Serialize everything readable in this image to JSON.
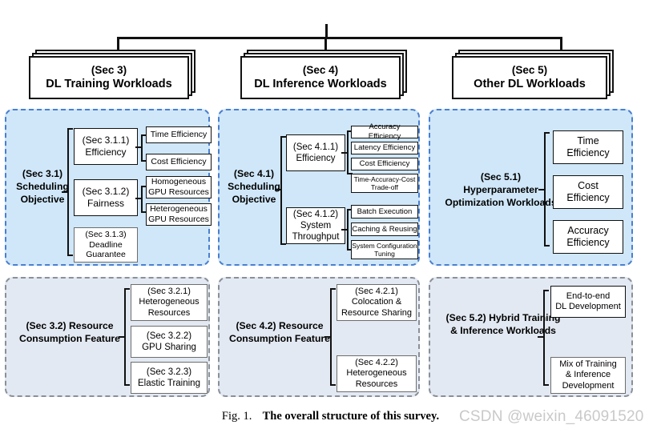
{
  "figure": {
    "caption_number": "Fig. 1.",
    "caption_title": "The overall structure of this survey.",
    "watermark": "CSDN @weixin_46091520"
  },
  "colors": {
    "panel_blue_fill": "#cfe7f8",
    "panel_blue_border": "#4a7fd0",
    "panel_gray_fill": "#e3e9f2",
    "panel_gray_border": "#8a8f98",
    "box_fill": "#ffffff",
    "line": "#111111",
    "watermark": "#c9c9c9"
  },
  "headers": [
    {
      "line1": "(Sec 3)",
      "line2": "DL Training Workloads"
    },
    {
      "line1": "(Sec 4)",
      "line2": "DL Inference Workloads"
    },
    {
      "line1": "(Sec 5)",
      "line2": "Other DL Workloads"
    }
  ],
  "panels": {
    "p31": {
      "title_lines": [
        "(Sec 3.1)",
        "Scheduling",
        "Objective"
      ],
      "mid": [
        {
          "lines": [
            "(Sec 3.1.1)",
            "Efficiency"
          ],
          "leaves": [
            {
              "lines": [
                "Time Efficiency"
              ]
            },
            {
              "lines": [
                "Cost Efficiency"
              ]
            }
          ]
        },
        {
          "lines": [
            "(Sec 3.1.2)",
            "Fairness"
          ],
          "leaves": [
            {
              "lines": [
                "Homogeneous",
                "GPU Resources"
              ]
            },
            {
              "lines": [
                "Heterogeneous",
                "GPU Resources"
              ]
            }
          ]
        },
        {
          "lines": [
            "(Sec 3.1.3)",
            "Deadline",
            "Guarantee"
          ],
          "leaves": []
        }
      ]
    },
    "p41": {
      "title_lines": [
        "(Sec 4.1)",
        "Scheduling",
        "Objective"
      ],
      "mid": [
        {
          "lines": [
            "(Sec 4.1.1)",
            "Efficiency"
          ],
          "leaves": [
            {
              "lines": [
                "Accuracy Efficiency"
              ]
            },
            {
              "lines": [
                "Latency Efficiency"
              ]
            },
            {
              "lines": [
                "Cost Efficiency"
              ]
            },
            {
              "lines": [
                "Time-Accuracy-Cost",
                "Trade-off"
              ]
            }
          ]
        },
        {
          "lines": [
            "(Sec 4.1.2)",
            "System",
            "Throughput"
          ],
          "leaves": [
            {
              "lines": [
                "Batch Execution"
              ]
            },
            {
              "lines": [
                "Caching & Reusing"
              ]
            },
            {
              "lines": [
                "System Configuration",
                "Tuning"
              ]
            }
          ]
        }
      ]
    },
    "p51": {
      "title_lines": [
        "(Sec 5.1)",
        "Hyperparameter",
        "Optimization Workloads"
      ],
      "leaves": [
        {
          "lines": [
            "Time",
            "Efficiency"
          ]
        },
        {
          "lines": [
            "Cost",
            "Efficiency"
          ]
        },
        {
          "lines": [
            "Accuracy",
            "Efficiency"
          ]
        }
      ]
    },
    "p32": {
      "title_lines": [
        "(Sec 3.2)",
        "Resource",
        "Consumption Feature"
      ],
      "leaves": [
        {
          "lines": [
            "(Sec 3.2.1)",
            "Heterogeneous",
            "Resources"
          ]
        },
        {
          "lines": [
            "(Sec 3.2.2)",
            "GPU Sharing"
          ]
        },
        {
          "lines": [
            "(Sec 3.2.3)",
            "Elastic Training"
          ]
        }
      ]
    },
    "p42": {
      "title_lines": [
        "(Sec 4.2)",
        "Resource",
        "Consumption Feature"
      ],
      "leaves": [
        {
          "lines": [
            "(Sec 4.2.1)",
            "Colocation &",
            "Resource Sharing"
          ]
        },
        {
          "lines": [
            "(Sec 4.2.2)",
            "Heterogeneous",
            "Resources"
          ]
        }
      ]
    },
    "p52": {
      "title_lines": [
        "(Sec 5.2)",
        "Hybrid",
        "Training & Inference",
        "Workloads"
      ],
      "leaves": [
        {
          "lines": [
            "End-to-end",
            "DL Development"
          ]
        },
        {
          "lines": [
            "Mix of Training",
            "& Inference",
            "Development"
          ]
        }
      ]
    }
  }
}
